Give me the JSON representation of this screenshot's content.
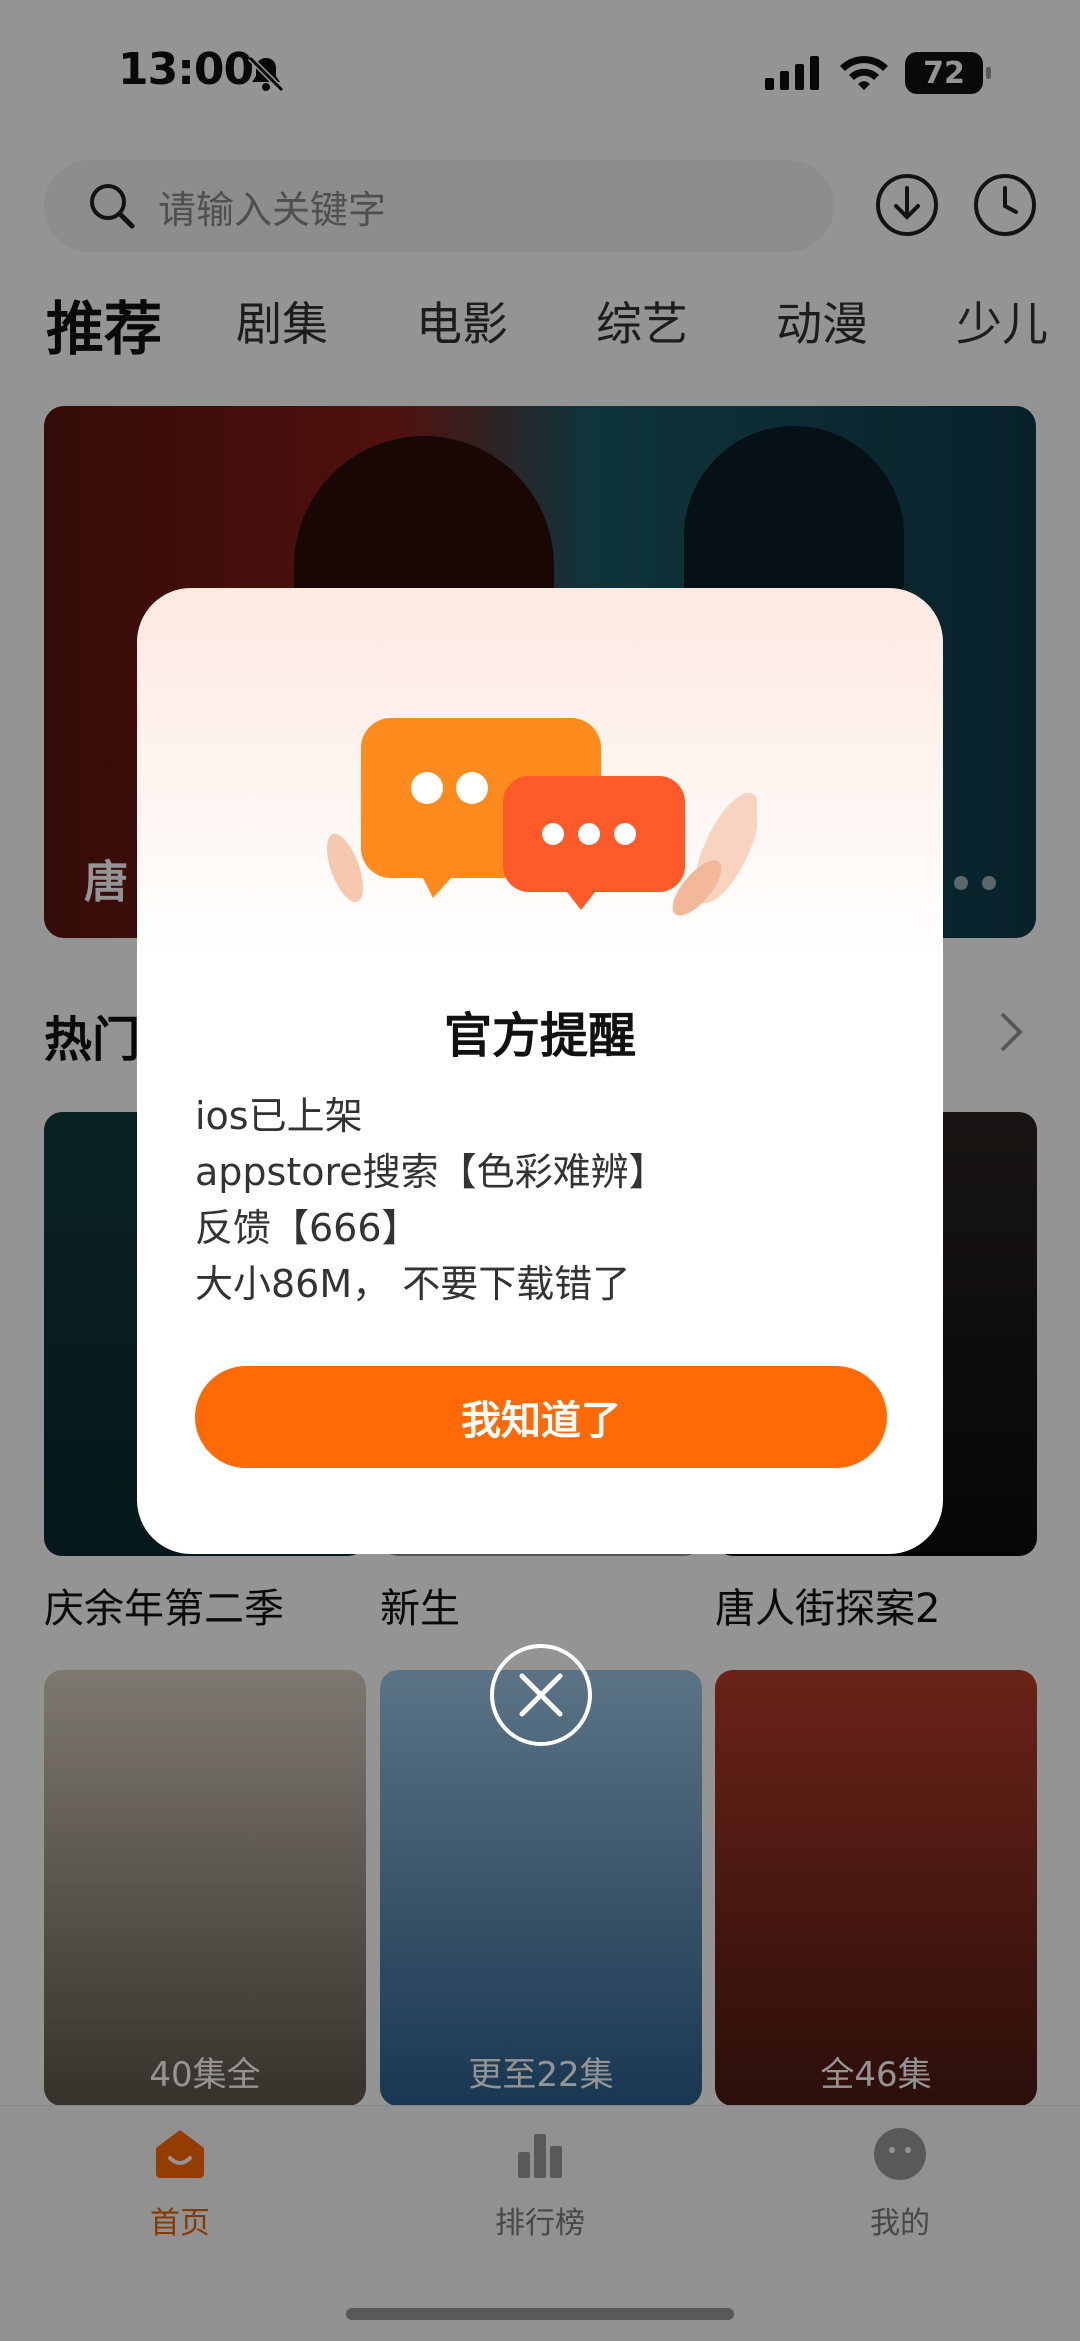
{
  "status_bar": {
    "time": "13:00",
    "battery": "72"
  },
  "search": {
    "placeholder": "请输入关键字"
  },
  "tabs": [
    "推荐",
    "剧集",
    "电影",
    "综艺",
    "动漫",
    "少儿"
  ],
  "banner": {
    "title_partial": "唐"
  },
  "section": {
    "title_partial": "热门"
  },
  "cards_row1": [
    {
      "title": "庆余年第二季"
    },
    {
      "title": "新生"
    },
    {
      "title": "唐人街探案2"
    }
  ],
  "cards_row2": [
    {
      "badge": "40集全"
    },
    {
      "badge": "更至22集"
    },
    {
      "badge": "全46集"
    }
  ],
  "bottom_nav": [
    {
      "label": "首页",
      "icon": "home-icon"
    },
    {
      "label": "排行榜",
      "icon": "ranking-icon"
    },
    {
      "label": "我的",
      "icon": "profile-icon"
    }
  ],
  "dialog": {
    "title": "官方提醒",
    "lines": [
      "ios已上架",
      "appstore搜索【色彩难辨】",
      "反馈【666】",
      "大小86M， 不要下载错了"
    ],
    "confirm_label": "我知道了"
  },
  "colors": {
    "accent": "#ff6a06"
  }
}
